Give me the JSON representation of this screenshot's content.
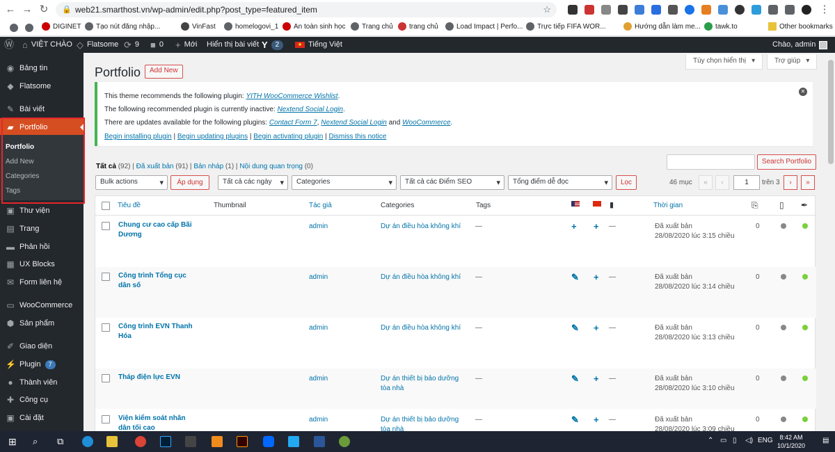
{
  "browser": {
    "url": "web21.smarthost.vn/wp-admin/edit.php?post_type=featured_item",
    "bookmarks": [
      "DIGINET",
      "Tạo nút đăng nhập...",
      "VinFast",
      "homelogovi_1",
      "An toàn sinh học",
      "Trang chủ",
      "trang chủ",
      "Load Impact | Perfo...",
      "Trực tiếp FIFA WOR...",
      "Hướng dẫn làm me...",
      "tawk.to"
    ],
    "other_bookmarks": "Other bookmarks"
  },
  "adminbar": {
    "site_name": "VIỆT CHÀO",
    "theme": "Flatsome",
    "updates": "9",
    "comments": "0",
    "new": "Mới",
    "view_post": "Hiển thị bài viết",
    "yoast_count": "2",
    "language": "Tiếng Việt",
    "greeting": "Chào, admin"
  },
  "sidebar": {
    "items": [
      {
        "label": "Bảng tin",
        "icon": "dashboard-icon"
      },
      {
        "label": "Flatsome",
        "icon": "flatsome-icon"
      },
      {
        "label": "Bài viết",
        "icon": "pin-icon"
      },
      {
        "label": "Portfolio",
        "icon": "folder-icon"
      },
      {
        "label": "Thư viện",
        "icon": "media-icon"
      },
      {
        "label": "Trang",
        "icon": "page-icon"
      },
      {
        "label": "Phản hồi",
        "icon": "comment-icon"
      },
      {
        "label": "UX Blocks",
        "icon": "blocks-icon"
      },
      {
        "label": "Form liên hệ",
        "icon": "mail-icon"
      },
      {
        "label": "WooCommerce",
        "icon": "woo-icon"
      },
      {
        "label": "Sản phẩm",
        "icon": "box-icon"
      },
      {
        "label": "Giao diện",
        "icon": "brush-icon"
      },
      {
        "label": "Plugin",
        "icon": "plugin-icon"
      },
      {
        "label": "Thành viên",
        "icon": "user-icon"
      },
      {
        "label": "Công cụ",
        "icon": "wrench-icon"
      },
      {
        "label": "Cài đặt",
        "icon": "settings-icon"
      }
    ],
    "plugin_badge": "7",
    "submenu": [
      "Portfolio",
      "Add New",
      "Categories",
      "Tags"
    ]
  },
  "screen_options": {
    "options": "Tùy chọn hiển thị",
    "help": "Trợ giúp"
  },
  "page": {
    "title": "Portfolio",
    "add_new": "Add New"
  },
  "notice": {
    "l1_pre": "This theme recommends the following plugin: ",
    "l1_link": "YITH WooCommerce Wishlist",
    "l2_pre": "The following recommended plugin is currently inactive: ",
    "l2_link": "Nextend Social Login",
    "l3_pre": "There are updates available for the following plugins: ",
    "l3_link1": "Contact Form 7",
    "l3_link2": "Nextend Social Login",
    "l3_and": " and ",
    "l3_link3": "WooCommerce",
    "links": [
      "Begin installing plugin",
      "Begin updating plugins",
      "Begin activating plugin",
      "Dismiss this notice"
    ]
  },
  "views": {
    "all": "Tất cả",
    "all_count": "(92)",
    "published": "Đã xuất bản",
    "published_count": "(91)",
    "draft": "Bản nháp",
    "draft_count": "(1)",
    "cornerstone": "Nội dung quan trọng",
    "cornerstone_count": "(0)"
  },
  "search": {
    "button": "Search Portfolio"
  },
  "filters": {
    "bulk": "Bulk actions",
    "apply": "Áp dụng",
    "dates": "Tất cả các ngày",
    "categories": "Categories",
    "seo": "Tất cả các Điểm SEO",
    "readability": "Tổng điểm dễ đọc",
    "filter": "Lọc"
  },
  "pagination": {
    "items": "46 mục",
    "current": "1",
    "of": "trên 3"
  },
  "columns": {
    "title": "Tiêu đề",
    "thumbnail": "Thumbnail",
    "author": "Tác giả",
    "categories": "Categories",
    "tags": "Tags",
    "date": "Thời gian"
  },
  "rows": [
    {
      "title": "Chung cư cao cấp Bãi Dương",
      "author": "admin",
      "category": "Dự án điều hòa không khí",
      "tags": "—",
      "lang1": "+",
      "lang2": "+",
      "comments": "—",
      "status": "Đã xuất bản",
      "date": "28/08/2020 lúc 3:15 chiều",
      "links": "0"
    },
    {
      "title": "Công trình Tổng cục dân số",
      "author": "admin",
      "category": "Dự án điều hòa không khí",
      "tags": "—",
      "lang1": "✎",
      "lang2": "+",
      "comments": "—",
      "status": "Đã xuất bản",
      "date": "28/08/2020 lúc 3:14 chiều",
      "links": "0"
    },
    {
      "title": "Công trình EVN Thanh Hóa",
      "author": "admin",
      "category": "Dự án điều hòa không khí",
      "tags": "—",
      "lang1": "✎",
      "lang2": "+",
      "comments": "—",
      "status": "Đã xuất bản",
      "date": "28/08/2020 lúc 3:13 chiều",
      "links": "0"
    },
    {
      "title": "Tháp điện lực EVN",
      "author": "admin",
      "category": "Dự án thiết bị bảo dưỡng tòa nhà",
      "tags": "—",
      "lang1": "✎",
      "lang2": "+",
      "comments": "—",
      "status": "Đã xuất bản",
      "date": "28/08/2020 lúc 3:10 chiều",
      "links": "0"
    },
    {
      "title": "Viện kiểm soát nhân dân tối cao",
      "author": "admin",
      "category": "Dự án thiết bị bảo dưỡng tòa nhà",
      "tags": "—",
      "lang1": "✎",
      "lang2": "+",
      "comments": "—",
      "status": "Đã xuất bản",
      "date": "28/08/2020 lúc 3:09 chiều",
      "links": "0"
    }
  ],
  "taskbar": {
    "lang": "ENG",
    "time": "8:42 AM",
    "date": "10/1/2020"
  },
  "colors": {
    "accent": "#0073aa",
    "active_menu": "#d54e21",
    "admin_bar": "#23282d",
    "highlight_box": "#e8252a",
    "notice_border": "#46b450"
  }
}
